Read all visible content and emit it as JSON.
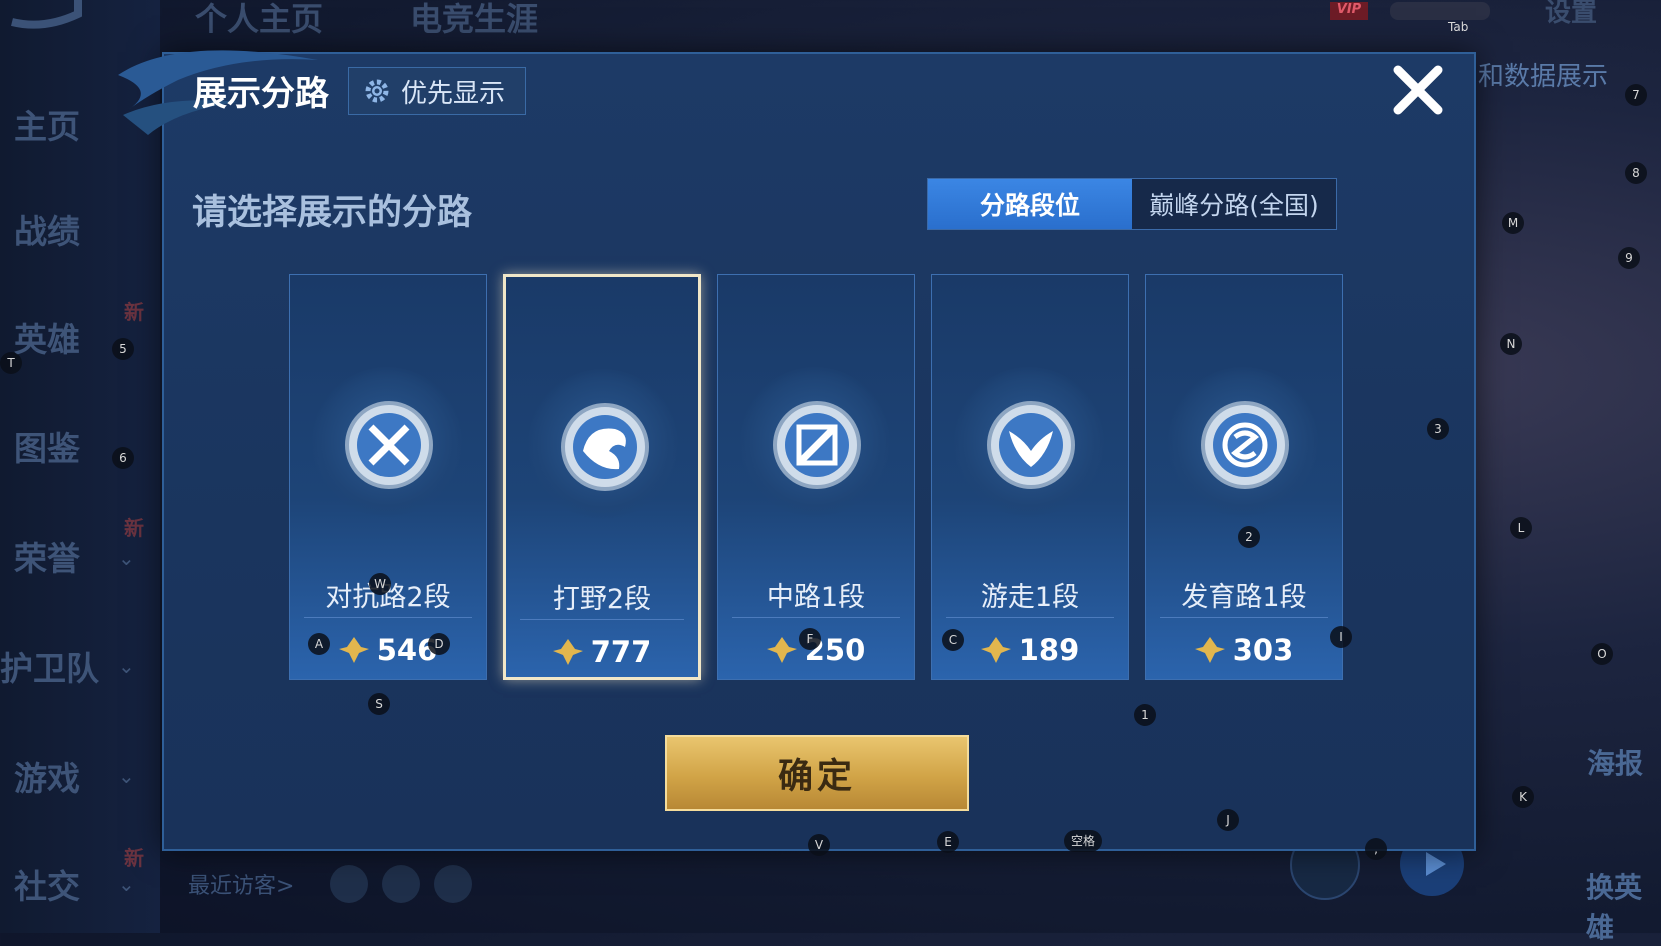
{
  "background": {
    "top_tabs": [
      "个人主页",
      "电竞生涯"
    ],
    "top_right": {
      "vip": "VIP",
      "settings": "设置"
    },
    "right_banner": "和数据展示",
    "sidebar": [
      {
        "label": "主页",
        "has_arrow": false,
        "new": false
      },
      {
        "label": "战绩",
        "has_arrow": false,
        "new": false
      },
      {
        "label": "英雄",
        "has_arrow": false,
        "new": true
      },
      {
        "label": "图鉴",
        "has_arrow": false,
        "new": false
      },
      {
        "label": "荣誉",
        "has_arrow": true,
        "new": true
      },
      {
        "label": "护卫队",
        "has_arrow": true,
        "new": false
      },
      {
        "label": "游戏",
        "has_arrow": true,
        "new": false
      },
      {
        "label": "社交",
        "has_arrow": true,
        "new": true
      }
    ],
    "new_badge": "新",
    "recent_visitors": "最近访客>",
    "right_buttons": {
      "poster": "海报",
      "switch_hero": "换英雄"
    }
  },
  "modal": {
    "title": "展示分路",
    "priority_button": "优先显示",
    "subtitle": "请选择展示的分路",
    "tabs": [
      {
        "label": "分路段位",
        "active": true
      },
      {
        "label": "巅峰分路(全国)",
        "active": false
      }
    ],
    "lanes": [
      {
        "name": "对抗路2段",
        "score": "546",
        "icon": "clash-lane-icon",
        "selected": false
      },
      {
        "name": "打野2段",
        "score": "777",
        "icon": "jungle-dragon-icon",
        "selected": true
      },
      {
        "name": "中路1段",
        "score": "250",
        "icon": "mid-lane-icon",
        "selected": false
      },
      {
        "name": "游走1段",
        "score": "189",
        "icon": "roam-wings-icon",
        "selected": false
      },
      {
        "name": "发育路1段",
        "score": "303",
        "icon": "farm-lane-icon",
        "selected": false
      }
    ],
    "confirm_label": "确定",
    "close_icon": "close-icon"
  },
  "key_hints": {
    "tab": "Tab",
    "k7": "7",
    "k8": "8",
    "M": "M",
    "k9": "9",
    "N": "N",
    "k3": "3",
    "L": "L",
    "O": "O",
    "K": "K",
    "k1": "1",
    "k2": "2",
    "I": "I",
    "J": "J",
    "T": "T",
    "k5": "5",
    "k6": "6",
    "A": "A",
    "D": "D",
    "W": "W",
    "S": "S",
    "F": "F",
    "C": "C",
    "V": "V",
    "E": "E",
    "space": "空格",
    "comma": ","
  },
  "colors": {
    "accent_blue": "#2f7bd9",
    "confirm_gold": "#d1a447",
    "selected_border": "#f1e7c8"
  }
}
